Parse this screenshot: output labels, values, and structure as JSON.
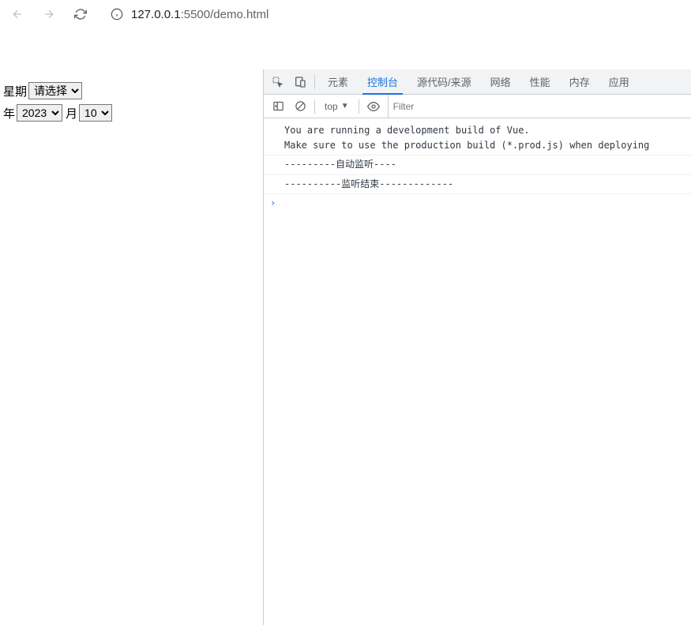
{
  "browser": {
    "url_host": "127.0.0.1",
    "url_port": ":5500",
    "url_path": "/demo.html"
  },
  "page": {
    "weekday_label": "星期",
    "weekday_value": "请选择",
    "year_label": "年",
    "year_value": "2023",
    "month_label": "月",
    "month_value": "10"
  },
  "devtools": {
    "tabs": {
      "elements": "元素",
      "console": "控制台",
      "sources": "源代码/来源",
      "network": "网络",
      "performance": "性能",
      "memory": "内存",
      "application": "应用"
    },
    "toolbar": {
      "context": "top",
      "filter_placeholder": "Filter"
    },
    "console": {
      "line1": "You are running a development build of Vue.",
      "line2": "Make sure to use the production build (*.prod.js) when deploying",
      "line3": "---------自动监听----",
      "line4": "----------监听结束-------------",
      "prompt": "›"
    }
  }
}
